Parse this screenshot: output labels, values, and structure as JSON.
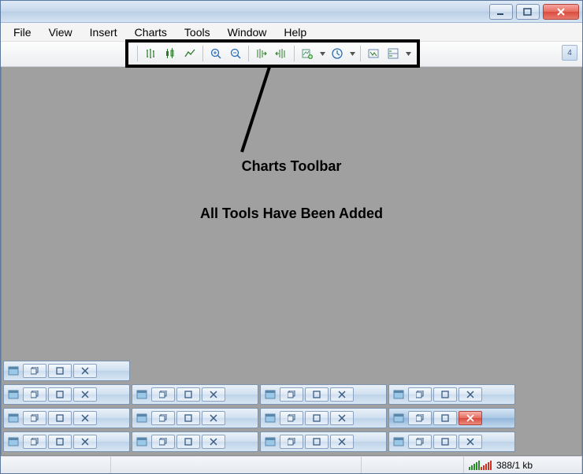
{
  "window_controls": {
    "minimize": "minimize",
    "maximize": "maximize",
    "close": "close"
  },
  "menu": {
    "items": [
      "File",
      "View",
      "Insert",
      "Charts",
      "Tools",
      "Window",
      "Help"
    ]
  },
  "toolbar": {
    "buttons": [
      {
        "name": "bar-chart-icon"
      },
      {
        "name": "candlestick-chart-icon"
      },
      {
        "name": "line-chart-icon"
      },
      {
        "name": "sep"
      },
      {
        "name": "zoom-in-icon"
      },
      {
        "name": "zoom-out-icon"
      },
      {
        "name": "sep"
      },
      {
        "name": "auto-scroll-icon"
      },
      {
        "name": "chart-shift-icon"
      },
      {
        "name": "sep"
      },
      {
        "name": "indicators-icon",
        "dropdown": true
      },
      {
        "name": "periods-icon",
        "dropdown": true
      },
      {
        "name": "sep"
      },
      {
        "name": "templates-icon"
      },
      {
        "name": "tile-icon",
        "dropdown": true
      }
    ],
    "highlight_label": "Charts Toolbar",
    "badge": "4"
  },
  "annotations": {
    "line_label": "Charts Toolbar",
    "body_label": "All Tools Have Been Added"
  },
  "child_windows": {
    "rows": 4,
    "cols": 4,
    "pattern": [
      [
        1,
        0,
        0,
        0
      ],
      [
        1,
        1,
        1,
        1
      ],
      [
        1,
        1,
        1,
        1
      ],
      [
        1,
        1,
        1,
        1
      ]
    ],
    "active_row": 2,
    "active_col": 3
  },
  "statusbar": {
    "traffic": "388/1 kb"
  }
}
